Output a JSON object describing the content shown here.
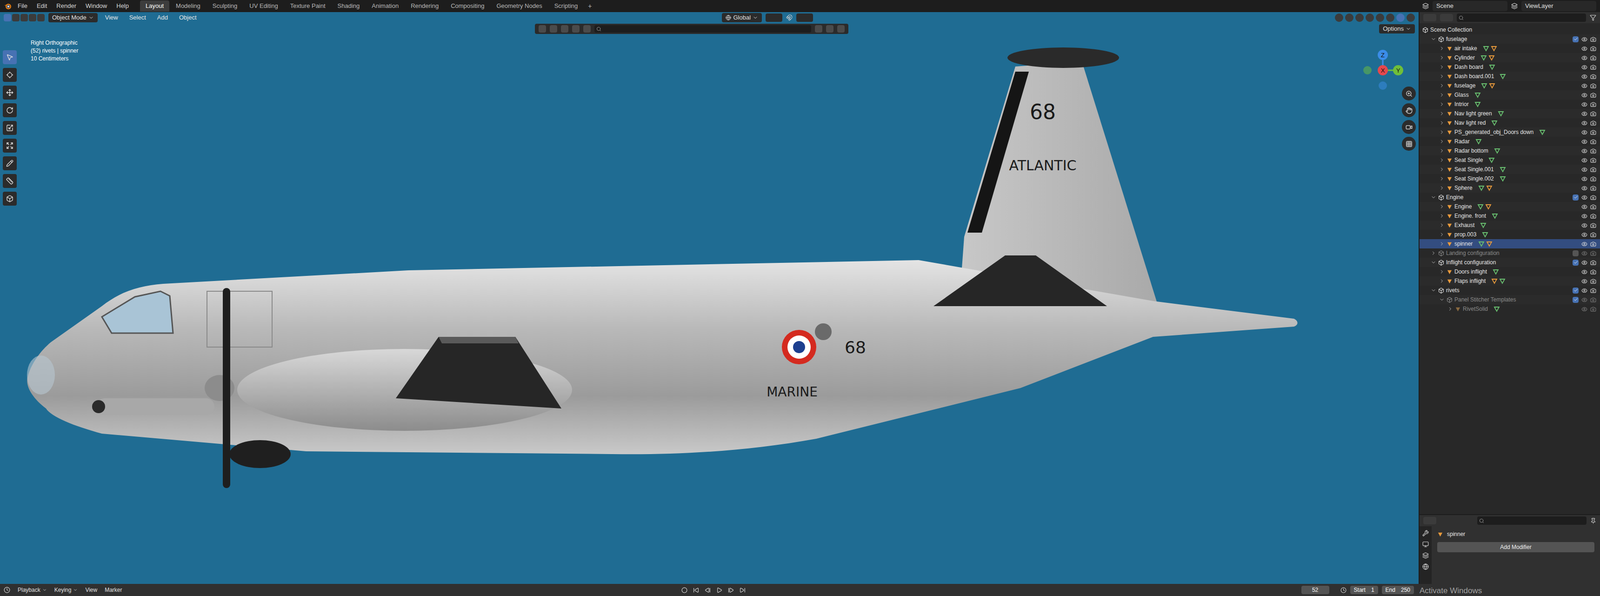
{
  "menubar": {
    "menus": [
      "File",
      "Edit",
      "Render",
      "Window",
      "Help"
    ],
    "workspaces": [
      {
        "label": "Layout",
        "selected": true
      },
      {
        "label": "Modeling",
        "selected": false
      },
      {
        "label": "Sculpting",
        "selected": false
      },
      {
        "label": "UV Editing",
        "selected": false
      },
      {
        "label": "Texture Paint",
        "selected": false
      },
      {
        "label": "Shading",
        "selected": false
      },
      {
        "label": "Animation",
        "selected": false
      },
      {
        "label": "Rendering",
        "selected": false
      },
      {
        "label": "Compositing",
        "selected": false
      },
      {
        "label": "Geometry Nodes",
        "selected": false
      },
      {
        "label": "Scripting",
        "selected": false
      }
    ],
    "add_tab": "+",
    "scene": "Scene",
    "view_layer": "ViewLayer"
  },
  "viewport_header": {
    "mode": "Object Mode",
    "menus": [
      "View",
      "Select",
      "Add",
      "Object"
    ],
    "orientation": "Global",
    "options": "Options"
  },
  "viewport": {
    "info": [
      "Right Orthographic",
      "(52) rivets | spinner",
      "10 Centimeters"
    ],
    "gizmo_axes": [
      {
        "label": "X",
        "color": "#e5484d"
      },
      {
        "label": "Y",
        "color": "#6fbf3a"
      },
      {
        "label": "Z",
        "color": "#3b8de8"
      }
    ],
    "markings": {
      "fin_number": "68",
      "fin_name": "ATLANTIC",
      "fuselage_number": "68",
      "fuselage_name": "MARINE"
    }
  },
  "outliner": {
    "root": {
      "name": "Scene Collection",
      "kind": "scene",
      "expanded": true,
      "included": true,
      "greyed": false,
      "selected": false,
      "badges": [],
      "children": [
        {
          "name": "fuselage",
          "kind": "collection",
          "expanded": true,
          "included": true,
          "greyed": false,
          "selected": false,
          "badges": [],
          "children": [
            {
              "name": "air intake",
              "kind": "object",
              "expanded": false,
              "included": true,
              "greyed": false,
              "selected": false,
              "badges": [
                "mesh",
                "modifier"
              ],
              "children": []
            },
            {
              "name": "Cylinder",
              "kind": "object",
              "expanded": false,
              "included": true,
              "greyed": false,
              "selected": false,
              "badges": [
                "mesh",
                "modifier"
              ],
              "children": []
            },
            {
              "name": "Dash board",
              "kind": "object",
              "expanded": false,
              "included": true,
              "greyed": false,
              "selected": false,
              "badges": [
                "mesh"
              ],
              "children": []
            },
            {
              "name": "Dash board.001",
              "kind": "object",
              "expanded": false,
              "included": true,
              "greyed": false,
              "selected": false,
              "badges": [
                "mesh"
              ],
              "children": []
            },
            {
              "name": "fuselage",
              "kind": "object",
              "expanded": false,
              "included": true,
              "greyed": false,
              "selected": false,
              "badges": [
                "mesh",
                "modifier"
              ],
              "children": []
            },
            {
              "name": "Glass",
              "kind": "object",
              "expanded": false,
              "included": true,
              "greyed": false,
              "selected": false,
              "badges": [
                "mesh"
              ],
              "children": []
            },
            {
              "name": "Intrior",
              "kind": "object",
              "expanded": false,
              "included": true,
              "greyed": false,
              "selected": false,
              "badges": [
                "mesh"
              ],
              "children": []
            },
            {
              "name": "Nav light green",
              "kind": "object",
              "expanded": false,
              "included": true,
              "greyed": false,
              "selected": false,
              "badges": [
                "mesh"
              ],
              "children": []
            },
            {
              "name": "Nav light red",
              "kind": "object",
              "expanded": false,
              "included": true,
              "greyed": false,
              "selected": false,
              "badges": [
                "mesh"
              ],
              "children": []
            },
            {
              "name": "PS_generated_obj_Doors down",
              "kind": "object",
              "expanded": false,
              "included": true,
              "greyed": false,
              "selected": false,
              "badges": [
                "mesh"
              ],
              "children": []
            },
            {
              "name": "Radar",
              "kind": "object",
              "expanded": false,
              "included": true,
              "greyed": false,
              "selected": false,
              "badges": [
                "mesh"
              ],
              "children": []
            },
            {
              "name": "Radar bottom",
              "kind": "object",
              "expanded": false,
              "included": true,
              "greyed": false,
              "selected": false,
              "badges": [
                "mesh"
              ],
              "children": []
            },
            {
              "name": "Seat Single",
              "kind": "object",
              "expanded": false,
              "included": true,
              "greyed": false,
              "selected": false,
              "badges": [
                "mesh"
              ],
              "children": []
            },
            {
              "name": "Seat Single.001",
              "kind": "object",
              "expanded": false,
              "included": true,
              "greyed": false,
              "selected": false,
              "badges": [
                "mesh"
              ],
              "children": []
            },
            {
              "name": "Seat Single.002",
              "kind": "object",
              "expanded": false,
              "included": true,
              "greyed": false,
              "selected": false,
              "badges": [
                "mesh"
              ],
              "children": []
            },
            {
              "name": "Sphere",
              "kind": "object",
              "expanded": false,
              "included": true,
              "greyed": false,
              "selected": false,
              "badges": [
                "mesh",
                "modifier"
              ],
              "children": []
            }
          ]
        },
        {
          "name": "Engine",
          "kind": "collection",
          "expanded": true,
          "included": true,
          "greyed": false,
          "selected": false,
          "badges": [],
          "children": [
            {
              "name": "Engine",
              "kind": "object",
              "expanded": false,
              "included": true,
              "greyed": false,
              "selected": false,
              "badges": [
                "mesh",
                "modifier"
              ],
              "children": []
            },
            {
              "name": "Engine. front",
              "kind": "object",
              "expanded": false,
              "included": true,
              "greyed": false,
              "selected": false,
              "badges": [
                "mesh"
              ],
              "children": []
            },
            {
              "name": "Exhaust",
              "kind": "object",
              "expanded": false,
              "included": true,
              "greyed": false,
              "selected": false,
              "badges": [
                "mesh"
              ],
              "children": []
            },
            {
              "name": "prop.003",
              "kind": "object",
              "expanded": false,
              "included": true,
              "greyed": false,
              "selected": false,
              "badges": [
                "mesh"
              ],
              "children": []
            },
            {
              "name": "spinner",
              "kind": "object",
              "expanded": false,
              "included": true,
              "greyed": false,
              "selected": true,
              "badges": [
                "mesh",
                "modifier"
              ],
              "children": []
            }
          ]
        },
        {
          "name": "Landing configuration",
          "kind": "collection",
          "expanded": false,
          "included": false,
          "greyed": true,
          "selected": false,
          "badges": [],
          "children": []
        },
        {
          "name": "Inflight configuration",
          "kind": "collection",
          "expanded": true,
          "included": true,
          "greyed": false,
          "selected": false,
          "badges": [],
          "children": [
            {
              "name": "Doors inflight",
              "kind": "object",
              "expanded": false,
              "included": true,
              "greyed": false,
              "selected": false,
              "badges": [
                "mesh"
              ],
              "children": []
            },
            {
              "name": "Flaps inflight",
              "kind": "object",
              "expanded": false,
              "included": true,
              "greyed": false,
              "selected": false,
              "badges": [
                "modifier",
                "mesh"
              ],
              "children": []
            }
          ]
        },
        {
          "name": "rivets",
          "kind": "collection",
          "expanded": true,
          "included": true,
          "greyed": false,
          "selected": false,
          "badges": [],
          "children": [
            {
              "name": "Panel Stitcher Templates",
              "kind": "collection",
              "expanded": true,
              "included": true,
              "greyed": true,
              "selected": false,
              "badges": [],
              "children": [
                {
                  "name": "RivetSolid",
                  "kind": "object",
                  "expanded": false,
                  "included": true,
                  "greyed": true,
                  "selected": false,
                  "badges": [
                    "mesh"
                  ],
                  "children": []
                }
              ]
            }
          ]
        }
      ]
    }
  },
  "properties": {
    "object": "spinner",
    "button": "Add Modifier"
  },
  "timeline": {
    "menus": [
      "Playback",
      "Keying",
      "View",
      "Marker"
    ],
    "current_frame": "52",
    "start_label": "Start",
    "start": "1",
    "end_label": "End",
    "end": "250"
  },
  "watermark": "Activate Windows"
}
